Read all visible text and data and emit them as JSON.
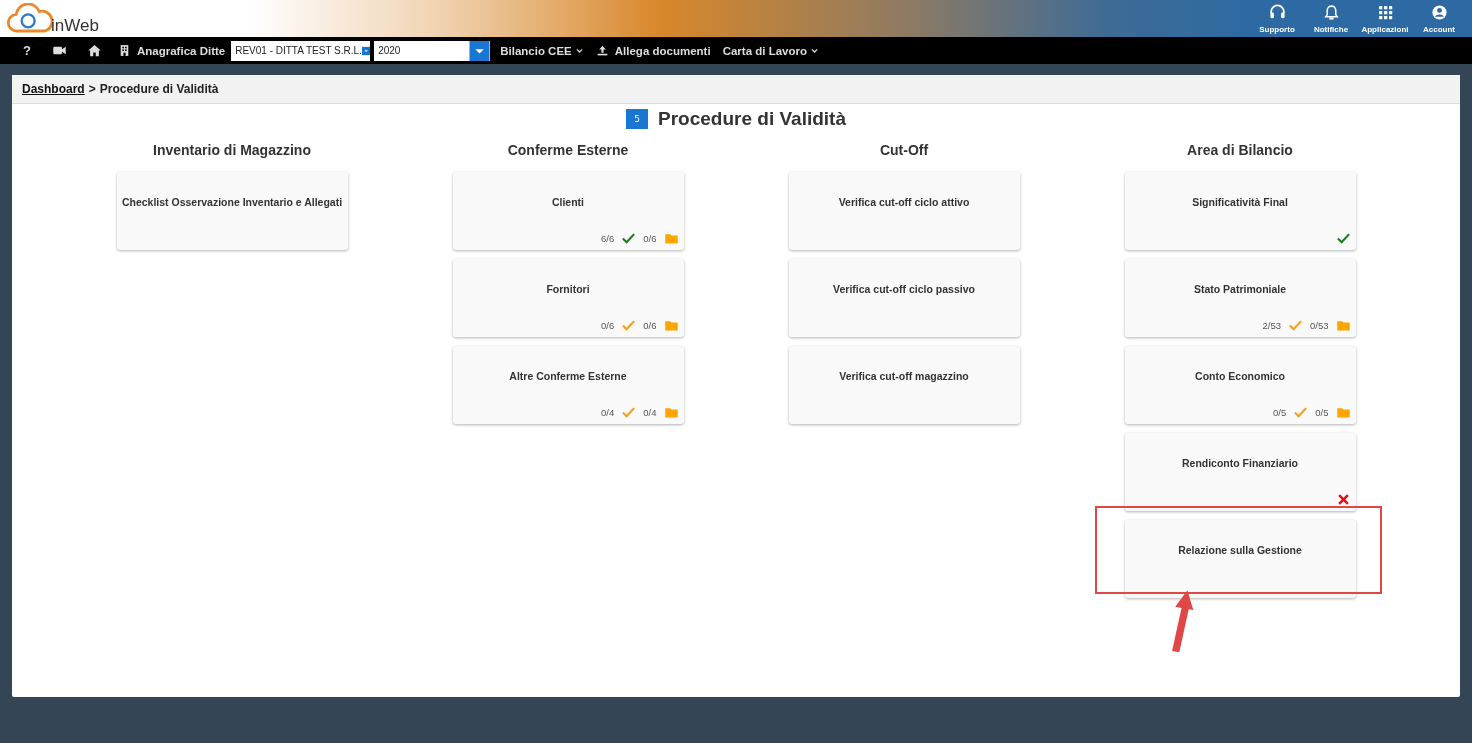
{
  "header": {
    "logo_text": "inWeb",
    "actions": [
      {
        "kind": "headset",
        "label": "Supporto"
      },
      {
        "kind": "bell",
        "label": "Notifiche"
      },
      {
        "kind": "grid",
        "label": "Applicazioni"
      },
      {
        "kind": "account",
        "label": "Account"
      }
    ]
  },
  "navbar": {
    "help": "?",
    "company_label": "Anagrafica Ditte",
    "company_value": "REV01 - DITTA TEST S.R.L.",
    "year_value": "2020",
    "menus": [
      {
        "kind": "dropdown",
        "label": "Bilancio CEE"
      },
      {
        "kind": "upload",
        "label": "Allega documenti"
      },
      {
        "kind": "dropdown",
        "label": "Carta di Lavoro"
      }
    ]
  },
  "breadcrumb": {
    "link": "Dashboard",
    "separator": ">",
    "current": "Procedure di Validità"
  },
  "page_title": {
    "badge": "5",
    "title": "Procedure di Validità"
  },
  "columns": [
    {
      "heading": "Inventario di Magazzino",
      "cards": [
        {
          "title": "Checklist Osservazione Inventario e Allegati"
        }
      ]
    },
    {
      "heading": "Conferme Esterne",
      "cards": [
        {
          "title": "Clienti",
          "status": {
            "kind": "counts",
            "done": "6/6",
            "complete": true,
            "docs": "0/6"
          }
        },
        {
          "title": "Fornitori",
          "status": {
            "kind": "counts",
            "done": "0/6",
            "complete": false,
            "docs": "0/6"
          }
        },
        {
          "title": "Altre Conferme Esterne",
          "status": {
            "kind": "counts",
            "done": "0/4",
            "complete": false,
            "docs": "0/4"
          }
        }
      ]
    },
    {
      "heading": "Cut-Off",
      "cards": [
        {
          "title": "Verifica cut-off ciclo attivo"
        },
        {
          "title": "Verifica cut-off ciclo passivo"
        },
        {
          "title": "Verifica cut-off magazzino"
        }
      ]
    },
    {
      "heading": "Area di Bilancio",
      "cards": [
        {
          "title": "Significatività Final",
          "status": {
            "kind": "check",
            "complete": true
          }
        },
        {
          "title": "Stato Patrimoniale",
          "status": {
            "kind": "counts",
            "done": "2/53",
            "complete": false,
            "docs": "0/53"
          }
        },
        {
          "title": "Conto Economico",
          "status": {
            "kind": "counts",
            "done": "0/5",
            "complete": false,
            "docs": "0/5"
          }
        },
        {
          "title": "Rendiconto Finanziario",
          "status": {
            "kind": "error"
          }
        },
        {
          "title": "Relazione sulla Gestione",
          "highlighted": true
        }
      ]
    }
  ]
}
